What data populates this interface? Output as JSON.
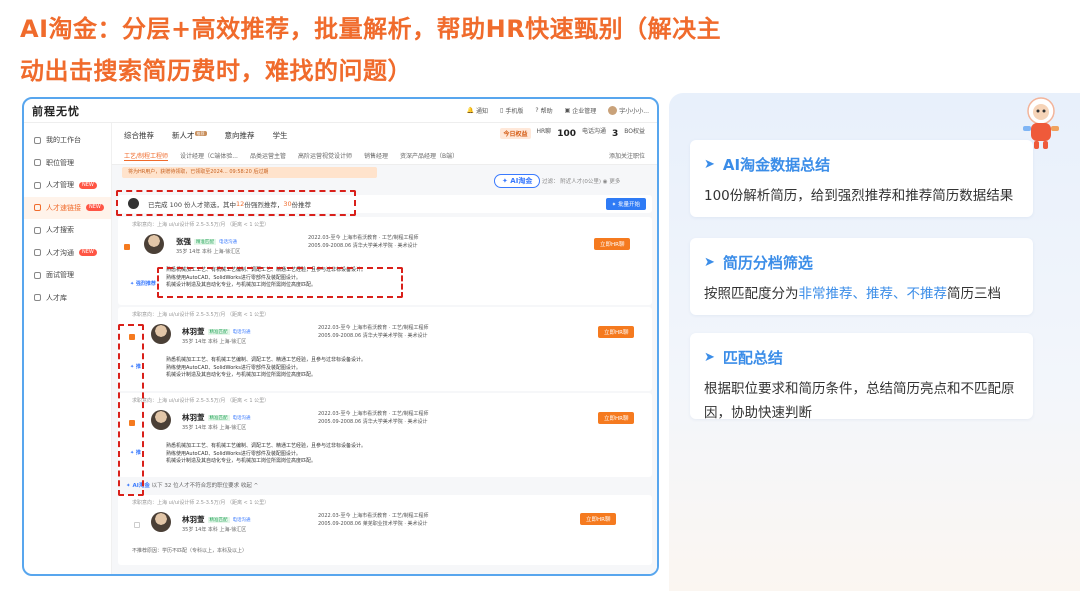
{
  "slide": {
    "title_line1": "AI淘金：分层+高效推荐，批量解析，帮助HR快速甄别（解决主",
    "title_line2": "动出击搜索简历费时，难找的问题）"
  },
  "app": {
    "brand": "前程无忧",
    "topbar": {
      "notice": "通知",
      "phone": "手机版",
      "help": "帮助",
      "enterprise": "企业管理",
      "user": "宇小小小..."
    },
    "sidebar": [
      {
        "label": "我的工作台"
      },
      {
        "label": "职位管理"
      },
      {
        "label": "人才管理",
        "badge": "NEW"
      },
      {
        "label": "人才速链接",
        "badge": "NEW"
      },
      {
        "label": "人才搜索"
      },
      {
        "label": "人才沟通",
        "badge": "NEW"
      },
      {
        "label": "面试管理"
      },
      {
        "label": "人才库"
      }
    ],
    "tabs": [
      "综合推荐",
      "新人才",
      "意向推荐",
      "学生"
    ],
    "tabs_badge": "推荐",
    "quota": {
      "today_label": "今日权益",
      "hr_label": "HR聊",
      "hr_value": "100",
      "phone_label": "电话沟通",
      "phone_value": "3",
      "rights_link": "BO权益"
    },
    "subtabs": [
      "工艺/制程工程师",
      "设计经理（C端体验...",
      "品类运营主管",
      "高阶运营视觉设计师",
      "销售经理",
      "资深产品经理（B端）"
    ],
    "subtab_right": "添加关注职位",
    "notice": "将为HR用户，获赠待领取，已领取至2024...  09:58:20 后过期",
    "ai_pill": "✦ AI淘金",
    "filter_text": "过滤：  附近人才(0公里)  ◉ 更多",
    "summary": {
      "pre": "已完成 100 份人才筛选，其中 ",
      "strong": "12",
      "mid": " 份强烈推荐，",
      "rec": "30",
      "post": " 份推荐"
    },
    "batch_button": "✦ 批量开始",
    "candidates": [
      {
        "meta": "求职意向：上海 ui/ui设计师 2.5-3.5万/月  （距离 < 1 公里）",
        "name": "张强",
        "tag_green": "精准匹配",
        "tag_blue": "电话沟通",
        "basic": "35岁  14年  本科  上海-徐汇区",
        "exp1": "2022.03-至今       上海市看沃教育 · 工艺/制程工程师",
        "exp2": "2005.09-2008.06  清华大学美术学院 · 美术设计",
        "chat": "立即HR聊",
        "hl_tag": "✦ 强烈推荐",
        "highlights": [
          "熟悉机械加工工艺、有机械工艺编制、调配工艺、精通工艺经验，且参与过非标设备设计。",
          "熟练使用AutoCAD、SolidWorks进行零部件及装配图设计。",
          "机械设计制造及其自动化专业，与机械加工岗位所需岗位高度匹配。"
        ]
      },
      {
        "meta": "求职意向：上海 ui/ui设计师 2.5-3.5万/月  （距离 < 1 公里）",
        "name": "林羽萱",
        "tag_green": "精准匹配",
        "tag_blue": "电话沟通",
        "basic": "35岁  14年  本科  上海-徐汇区",
        "exp1": "2022.03-至今       上海市看沃教育 · 工艺/制程工程师",
        "exp2": "2005.09-2008.06  清华大学美术学院 · 美术设计",
        "chat": "立即HR聊",
        "hl_tag": "✦ 推",
        "highlights": [
          "熟悉机械加工工艺、有机械工艺编制、调配工艺、精通工艺经验，且参与过非标设备设计。",
          "熟练使用AutoCAD、SolidWorks进行零部件及装配图设计。",
          "机械设计制造及其自动化专业，与机械加工岗位所需岗位高度匹配。"
        ]
      },
      {
        "meta": "求职意向：上海 ui/ui设计师 2.5-3.5万/月  （距离 < 1 公里）",
        "name": "林羽萱",
        "tag_green": "精准匹配",
        "tag_blue": "电话沟通",
        "basic": "35岁  14年  本科  上海-徐汇区",
        "exp1": "2022.03-至今       上海市看沃教育 · 工艺/制程工程师",
        "exp2": "2005.09-2008.06  清华大学美术学院 · 美术设计",
        "chat": "立即HR聊",
        "hl_tag": "✦ 推",
        "highlights": [
          "熟悉机械加工工艺、有机械工艺编制、调配工艺、精通工艺经验，且参与过非标设备设计。",
          "熟练使用AutoCAD、SolidWorks进行零部件及装配图设计。",
          "机械设计制造及其自动化专业，与机械加工岗位所需岗位高度匹配。"
        ]
      },
      {
        "meta": "求职意向：上海 ui/ui设计师 2.5-3.5万/月  （距离 < 1 公里）",
        "name": "林羽萱",
        "tag_green": "精准匹配",
        "tag_blue": "电话沟通",
        "basic": "35岁  14年  本科  上海-徐汇区",
        "exp1": "2022.03-至今       上海市看沃教育 · 工艺/制程工程师",
        "exp2": "2005.09-2008.06  莱芜职业技术学院 · 美术设计",
        "chat": "立即HR聊"
      }
    ],
    "fold": {
      "ai": "✦ AI淘金",
      "text": " 以下 32 位人才不符合您的职位要求  收起 ^"
    },
    "nomatch": "不推荐原因：学历不匹配（专科以上，本科及以上）"
  },
  "right": {
    "cards": [
      {
        "title": "AI淘金数据总结",
        "body": "100份解析简历，给到强烈推荐和推荐简历数据结果"
      },
      {
        "title": "简历分档筛选",
        "body_pre": "按照匹配度分为",
        "body_blue": "非常推荐、推荐、不推荐",
        "body_post": "简历三档"
      },
      {
        "title": "匹配总结",
        "body": "根据职位要求和简历条件，总结简历亮点和不匹配原因，协助快速判断"
      }
    ]
  },
  "colors": {
    "accent_orange": "#f06b2c",
    "accent_blue": "#3b8de8",
    "dash_red": "#d9201a",
    "frame_blue": "#58a6ee"
  }
}
